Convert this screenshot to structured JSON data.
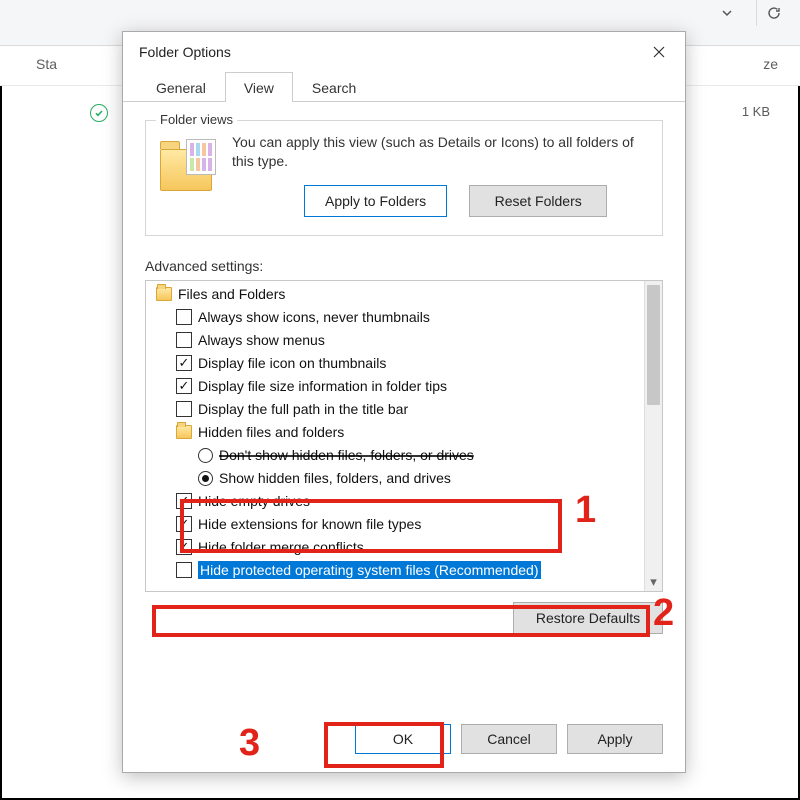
{
  "bg": {
    "sta_label": "Sta",
    "ze_label": "ze",
    "filesize": "1 KB"
  },
  "dialog": {
    "title": "Folder Options",
    "tabs": {
      "general": "General",
      "view": "View",
      "search": "Search"
    },
    "folderviews": {
      "group_title": "Folder views",
      "text": "You can apply this view (such as Details or Icons) to all folders of this type.",
      "apply_btn": "Apply to Folders",
      "reset_btn": "Reset Folders"
    },
    "advanced_label": "Advanced settings:",
    "items": {
      "files_folders": "Files and Folders",
      "always_icons": "Always show icons, never thumbnails",
      "always_menus": "Always show menus",
      "display_icon_thumb": "Display file icon on thumbnails",
      "display_size_tips": "Display file size information in folder tips",
      "display_full_path": "Display the full path in the title bar",
      "hidden_header": "Hidden files and folders",
      "dont_show_hidden": "Don't show hidden files, folders, or drives",
      "show_hidden": "Show hidden files, folders, and drives",
      "hide_empty": "Hide empty drives",
      "hide_ext": "Hide extensions for known file types",
      "hide_merge": "Hide folder merge conflicts",
      "hide_protected": "Hide protected operating system files (Recommended)"
    },
    "restore_btn": "Restore Defaults",
    "ok_btn": "OK",
    "cancel_btn": "Cancel",
    "apply_btn": "Apply"
  },
  "annotations": {
    "n1": "1",
    "n2": "2",
    "n3": "3"
  }
}
